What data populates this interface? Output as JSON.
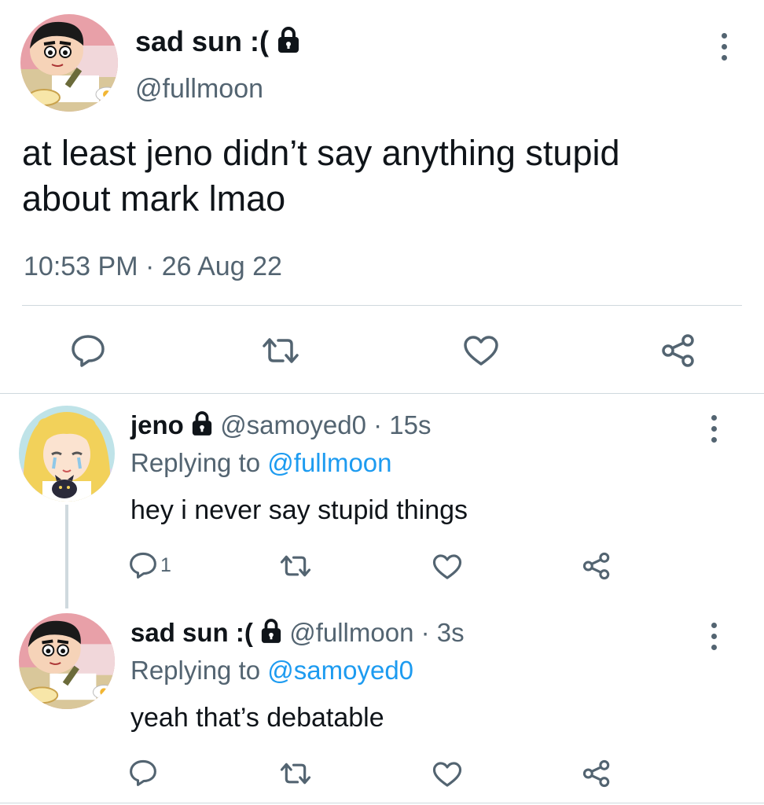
{
  "main_tweet": {
    "display_name": "sad sun :(",
    "handle": "@fullmoon",
    "text_line1": "at least jeno didn’t say anything stupid",
    "text_line2": "about mark lmao",
    "timestamp": "10:53 PM · 26 Aug 22",
    "avatar_icon": "cartoon-boy-avatar",
    "protected_icon": "lock-icon"
  },
  "replies": [
    {
      "display_name": "jeno",
      "handle": "@samoyed0",
      "separator": "·",
      "time": "15s",
      "replying_prefix": "Replying to",
      "replying_to": "@fullmoon",
      "text": "hey i never say stupid things",
      "reply_count": "1",
      "avatar_icon": "anime-girl-avatar"
    },
    {
      "display_name": "sad sun :(",
      "handle": "@fullmoon",
      "separator": "·",
      "time": "3s",
      "replying_prefix": "Replying to",
      "replying_to": "@samoyed0",
      "text": "yeah that’s debatable",
      "reply_count": "",
      "avatar_icon": "cartoon-boy-avatar"
    }
  ],
  "actions": [
    "reply-icon",
    "retweet-icon",
    "like-icon",
    "share-icon"
  ],
  "colors": {
    "text": "#0f1419",
    "secondary": "#536471",
    "link": "#1d9bf0",
    "divider": "#cfd9de"
  }
}
